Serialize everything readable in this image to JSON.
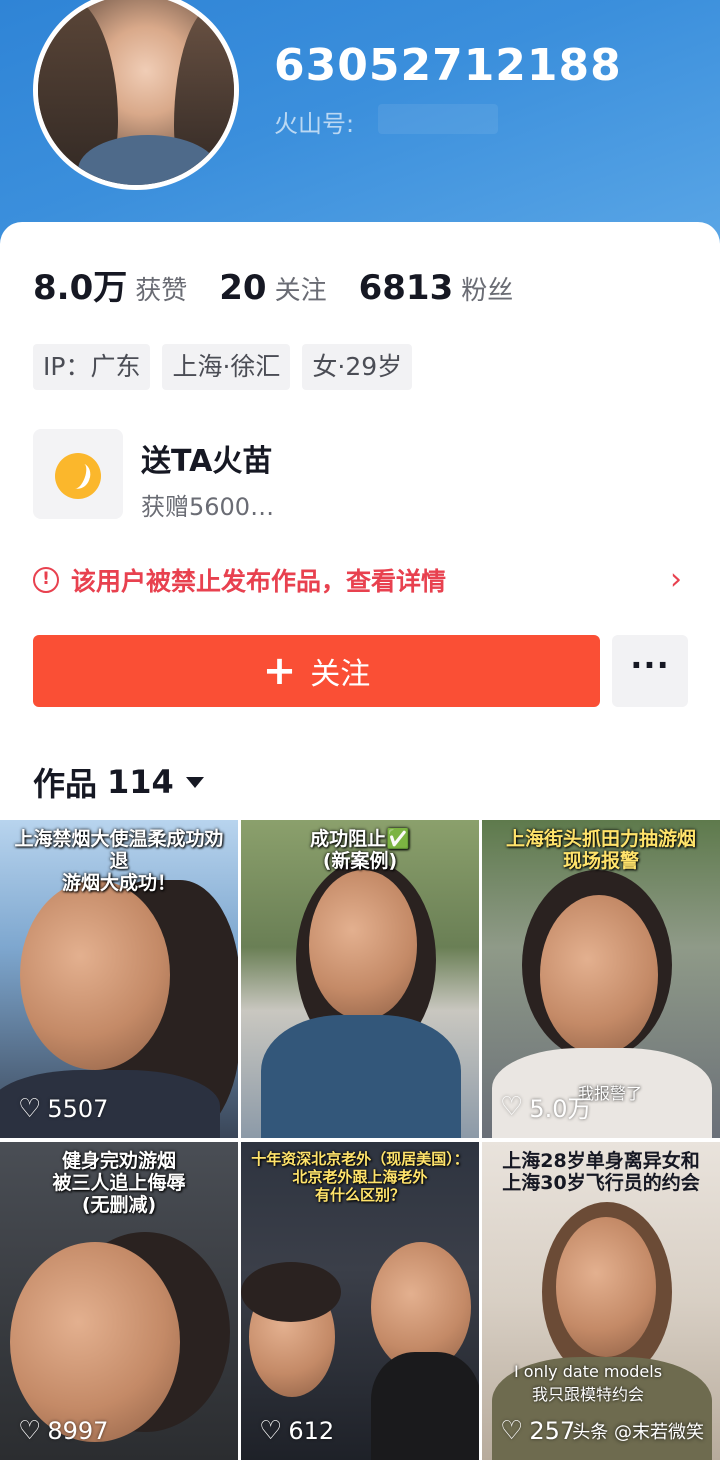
{
  "profile": {
    "user_id": "63052712188",
    "handle_label": "火山号:"
  },
  "stats": [
    {
      "value": "8.0万",
      "label": "获赞"
    },
    {
      "value": "20",
      "label": "关注"
    },
    {
      "value": "6813",
      "label": "粉丝"
    }
  ],
  "tags": [
    "IP：广东",
    "上海·徐汇",
    "女·29岁"
  ],
  "gift": {
    "title": "送TA火苗",
    "subtitle": "获赠5600…"
  },
  "warning": {
    "icon": "!",
    "text": "该用户被禁止发布作品，查看详情",
    "chevron": "›"
  },
  "actions": {
    "follow_plus": "+",
    "follow_label": "关注",
    "more_label": "···"
  },
  "works": {
    "label": "作品",
    "count": "114"
  },
  "videos": [
    {
      "caption": "上海禁烟大使温柔成功劝退\n游烟大成功！",
      "likes": "5507",
      "overlay": ""
    },
    {
      "caption": "成功阻止✅\n(新案例)",
      "likes": "",
      "overlay": ""
    },
    {
      "caption": "上海街头抓田力抽游烟\n现场报警",
      "likes": "5.0万",
      "overlay": "我报警了"
    },
    {
      "caption": "健身完劝游烟\n被三人追上侮辱\n(无删减)",
      "likes": "8997",
      "overlay": ""
    },
    {
      "caption": "十年资深北京老外（现居美国）：\n北京老外跟上海老外\n有什么区别？",
      "likes": "612",
      "overlay": ""
    },
    {
      "caption": "上海28岁单身离异女和\n上海30岁飞行员的约会",
      "likes": "257",
      "overlay": "I only date models\n我只跟模特约会"
    }
  ],
  "watermark": "头条 @末若微笑",
  "colors": {
    "header_blue": "#2f84d6",
    "follow_red": "#fa4f35",
    "warning_red": "#e8414f"
  }
}
